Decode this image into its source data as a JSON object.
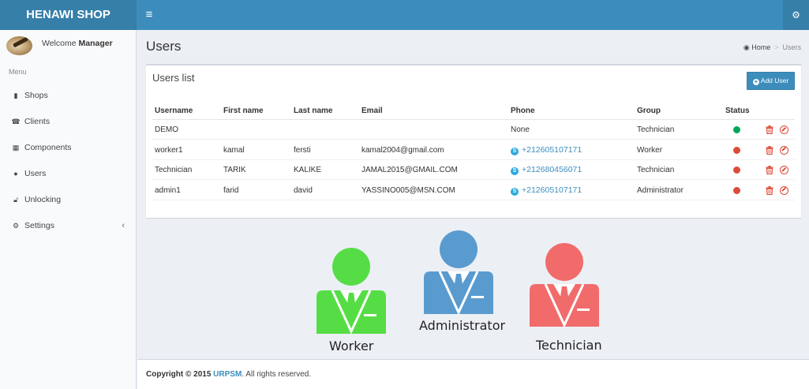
{
  "header": {
    "brand": "HENAWI SHOP",
    "menu_icon": "hamburger-icon",
    "settings_icon": "cogs-icon"
  },
  "sidebar": {
    "welcome_prefix": "Welcome",
    "user_name": "Manager",
    "menu_header": "Menu",
    "items": [
      {
        "label": "Shops",
        "icon": "book-icon"
      },
      {
        "label": "Clients",
        "icon": "phone-square-icon"
      },
      {
        "label": "Components",
        "icon": "grid-icon"
      },
      {
        "label": "Users",
        "icon": "users-icon"
      },
      {
        "label": "Unlocking",
        "icon": "unlock-icon"
      },
      {
        "label": "Settings",
        "icon": "gear-icon"
      }
    ]
  },
  "page": {
    "title": "Users",
    "breadcrumb_home": "Home",
    "breadcrumb_current": "Users"
  },
  "users_box": {
    "title": "Users list",
    "add_button": "Add User",
    "columns": [
      "Username",
      "First name",
      "Last name",
      "Email",
      "Phone",
      "Group",
      "Status"
    ],
    "rows": [
      {
        "username": "DEMO",
        "first_name": "",
        "last_name": "",
        "email": "",
        "phone": "None",
        "phone_is_link": false,
        "group": "Technician",
        "status": "active",
        "status_color": "#00a65a"
      },
      {
        "username": "worker1",
        "first_name": "kamal",
        "last_name": "fersti",
        "email": "kamal2004@gmail.com",
        "phone": "+212605107171",
        "phone_is_link": true,
        "group": "Worker",
        "status": "inactive",
        "status_color": "#dd4b39"
      },
      {
        "username": "Technician",
        "first_name": "TARIK",
        "last_name": "KALIKE",
        "email": "JAMAL2015@GMAIL.COM",
        "phone": "+212680456071",
        "phone_is_link": true,
        "group": "Technician",
        "status": "inactive",
        "status_color": "#dd4b39"
      },
      {
        "username": "admin1",
        "first_name": "farid",
        "last_name": "david",
        "email": "YASSINO005@MSN.COM",
        "phone": "+212605107171",
        "phone_is_link": true,
        "group": "Administrator",
        "status": "inactive",
        "status_color": "#dd4b39"
      }
    ]
  },
  "roles_graphic": {
    "worker": {
      "label": "Worker",
      "color": "#56dd45"
    },
    "administrator": {
      "label": "Administrator",
      "color": "#5a9bcf"
    },
    "technician": {
      "label": "Technician",
      "color": "#f26b6b"
    }
  },
  "footer": {
    "prefix": "Copyright © 2015",
    "brand": "URPSM",
    "suffix": ". All rights reserved."
  },
  "colors": {
    "primary": "#3c8dbc",
    "primary_dark": "#367fa9",
    "danger": "#dd4b39",
    "success": "#00a65a"
  }
}
